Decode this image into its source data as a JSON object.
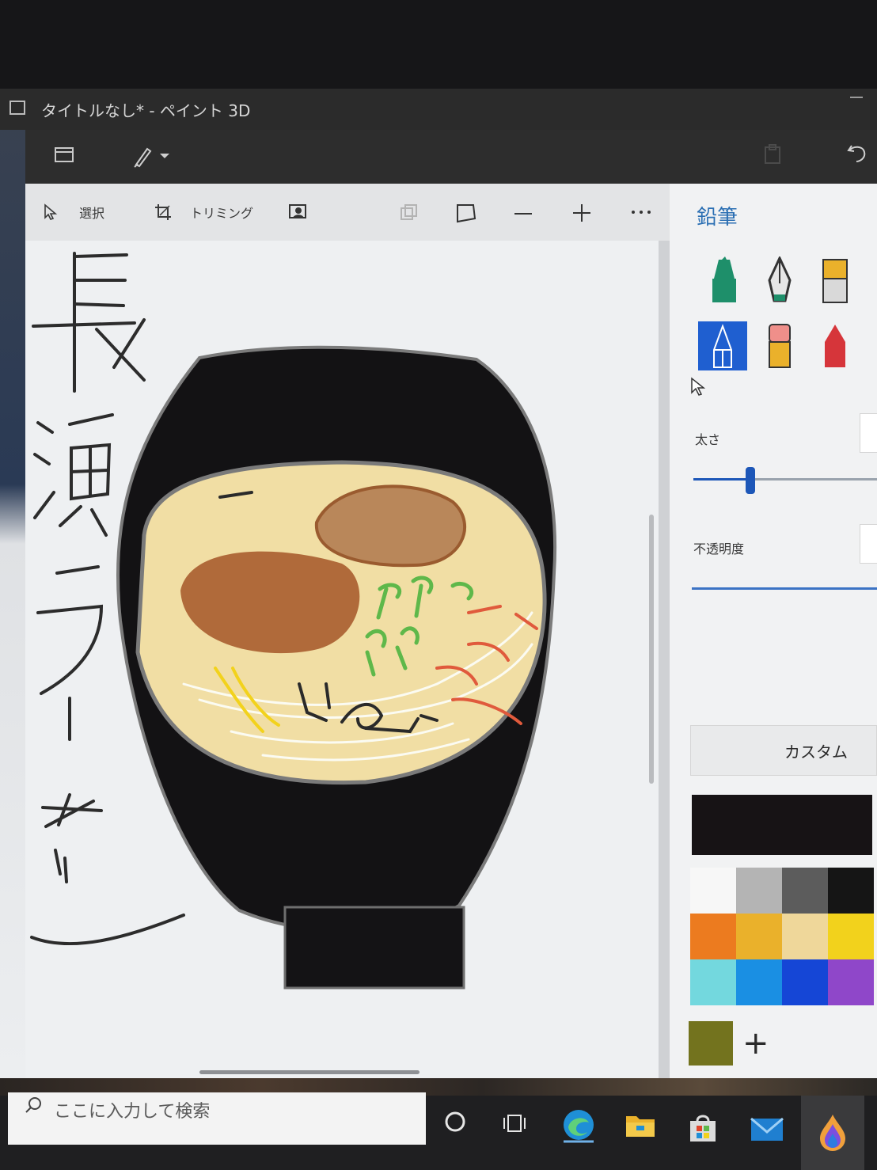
{
  "window": {
    "title": "タイトルなし* - ペイント 3D"
  },
  "toolbar": {
    "select_label": "選択",
    "crop_label": "トリミング"
  },
  "panel": {
    "title": "鉛筆",
    "tools": [
      {
        "name": "marker",
        "selected": false
      },
      {
        "name": "calligraphy-pen",
        "selected": false
      },
      {
        "name": "oil-brush",
        "selected": false
      },
      {
        "name": "pencil",
        "selected": true
      },
      {
        "name": "eraser",
        "selected": false
      },
      {
        "name": "crayon",
        "selected": false
      }
    ],
    "thickness_label": "太さ",
    "opacity_label": "不透明度",
    "custom_label": "カスタム",
    "current_color": "#171315",
    "palette": [
      "#f7f7f7",
      "#b4b4b4",
      "#5c5c5c",
      "#151515",
      "#ec7b1f",
      "#eab12b",
      "#efd79a",
      "#f2d21c",
      "#73d8de",
      "#1a8fe3",
      "#1546d6",
      "#8f47c9"
    ],
    "custom_color": "#73731e"
  },
  "drawing": {
    "vertical_text": "長浜ラーメン",
    "colors": {
      "bowl": "#131214",
      "broth": "#f1dea4",
      "chashu": "#b06a3a",
      "chashu2": "#b9875a",
      "negi": "#5fb84a",
      "benishoga": "#e05a3c",
      "noodle": "#fbfbf2"
    }
  },
  "taskbar": {
    "search_placeholder": "ここに入力して検索"
  }
}
